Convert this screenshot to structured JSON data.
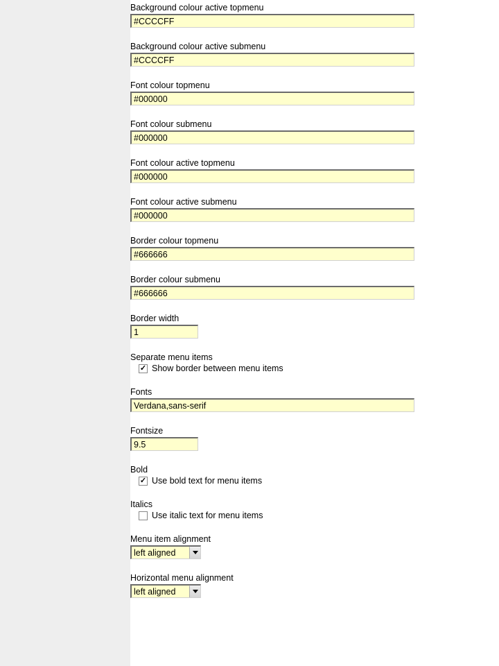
{
  "fields": {
    "bg_active_top": {
      "label": "Background colour active topmenu",
      "value": "#CCCCFF"
    },
    "bg_active_sub": {
      "label": "Background colour active submenu",
      "value": "#CCCCFF"
    },
    "font_top": {
      "label": "Font colour topmenu",
      "value": "#000000"
    },
    "font_sub": {
      "label": "Font colour submenu",
      "value": "#000000"
    },
    "font_active_top": {
      "label": "Font colour active topmenu",
      "value": "#000000"
    },
    "font_active_sub": {
      "label": "Font colour active submenu",
      "value": "#000000"
    },
    "border_top": {
      "label": "Border colour topmenu",
      "value": "#666666"
    },
    "border_sub": {
      "label": "Border colour submenu",
      "value": "#666666"
    },
    "border_width": {
      "label": "Border width",
      "value": "1"
    },
    "separate": {
      "label": "Separate menu items",
      "check_label": "Show border between menu items",
      "checked": true
    },
    "fonts": {
      "label": "Fonts",
      "value": "Verdana,sans-serif"
    },
    "fontsize": {
      "label": "Fontsize",
      "value": "9.5"
    },
    "bold": {
      "label": "Bold",
      "check_label": "Use bold text for menu items",
      "checked": true
    },
    "italics": {
      "label": "Italics",
      "check_label": "Use italic text for menu items",
      "checked": false
    },
    "item_align": {
      "label": "Menu item alignment",
      "value": "left aligned"
    },
    "horiz_align": {
      "label": "Horizontal menu alignment",
      "value": "left aligned"
    }
  }
}
